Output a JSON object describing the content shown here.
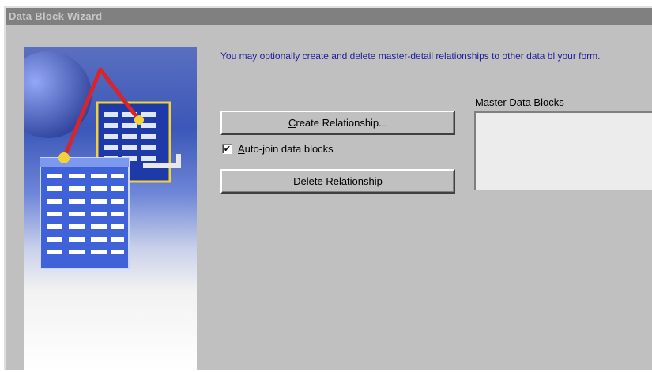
{
  "window": {
    "title": "Data Block Wizard"
  },
  "intro_text": "You may optionally create and delete master-detail relationships to other data bl your form.",
  "buttons": {
    "create_prefix": "",
    "create_mnemonic": "C",
    "create_rest": "reate Relationship...",
    "delete_prefix": "De",
    "delete_mnemonic": "l",
    "delete_rest": "ete Relationship"
  },
  "autojoin": {
    "checked": true,
    "check_glyph": "✔",
    "mnemonic": "A",
    "label_rest": "uto-join data blocks"
  },
  "master_blocks": {
    "label_prefix": "Master Data ",
    "label_mnemonic": "B",
    "label_rest": "locks",
    "items": []
  },
  "colors": {
    "dialog_face": "#c0c0c0",
    "title_bar": "#808080",
    "intro_text": "#2020a0"
  }
}
